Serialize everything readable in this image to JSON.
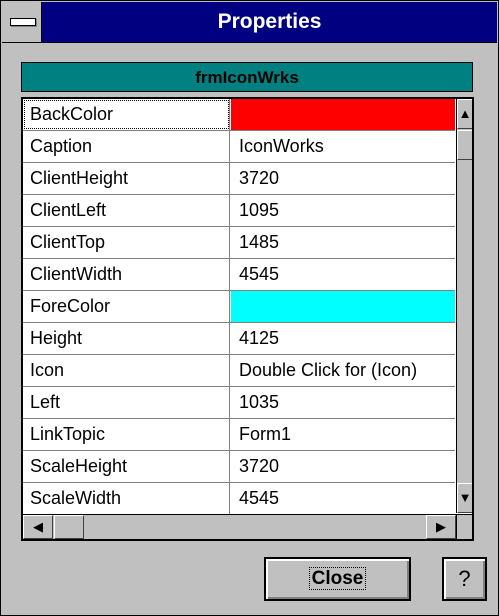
{
  "window": {
    "title": "Properties"
  },
  "object": {
    "name": "frmIconWrks"
  },
  "properties": [
    {
      "name": "BackColor",
      "value": "",
      "color": "#ff0000"
    },
    {
      "name": "Caption",
      "value": "IconWorks"
    },
    {
      "name": "ClientHeight",
      "value": "3720"
    },
    {
      "name": "ClientLeft",
      "value": "1095"
    },
    {
      "name": "ClientTop",
      "value": "1485"
    },
    {
      "name": "ClientWidth",
      "value": "4545"
    },
    {
      "name": "ForeColor",
      "value": "",
      "color": "#00ffff"
    },
    {
      "name": "Height",
      "value": "4125"
    },
    {
      "name": "Icon",
      "value": "Double Click for (Icon)"
    },
    {
      "name": "Left",
      "value": "1035"
    },
    {
      "name": "LinkTopic",
      "value": "Form1"
    },
    {
      "name": "ScaleHeight",
      "value": "3720"
    },
    {
      "name": "ScaleWidth",
      "value": "4545"
    }
  ],
  "scroll": {
    "up_icon": "arrow-up-icon",
    "down_icon": "arrow-down-icon",
    "left_icon": "arrow-left-icon",
    "right_icon": "arrow-right-icon",
    "up_glyph": "▲",
    "down_glyph": "▼",
    "left_glyph": "◀",
    "right_glyph": "▶"
  },
  "buttons": {
    "close_label": "Close",
    "help_label": "?"
  },
  "colors": {
    "titlebar": "#000080",
    "objectbar": "#008080",
    "face": "#c0c0c0"
  }
}
